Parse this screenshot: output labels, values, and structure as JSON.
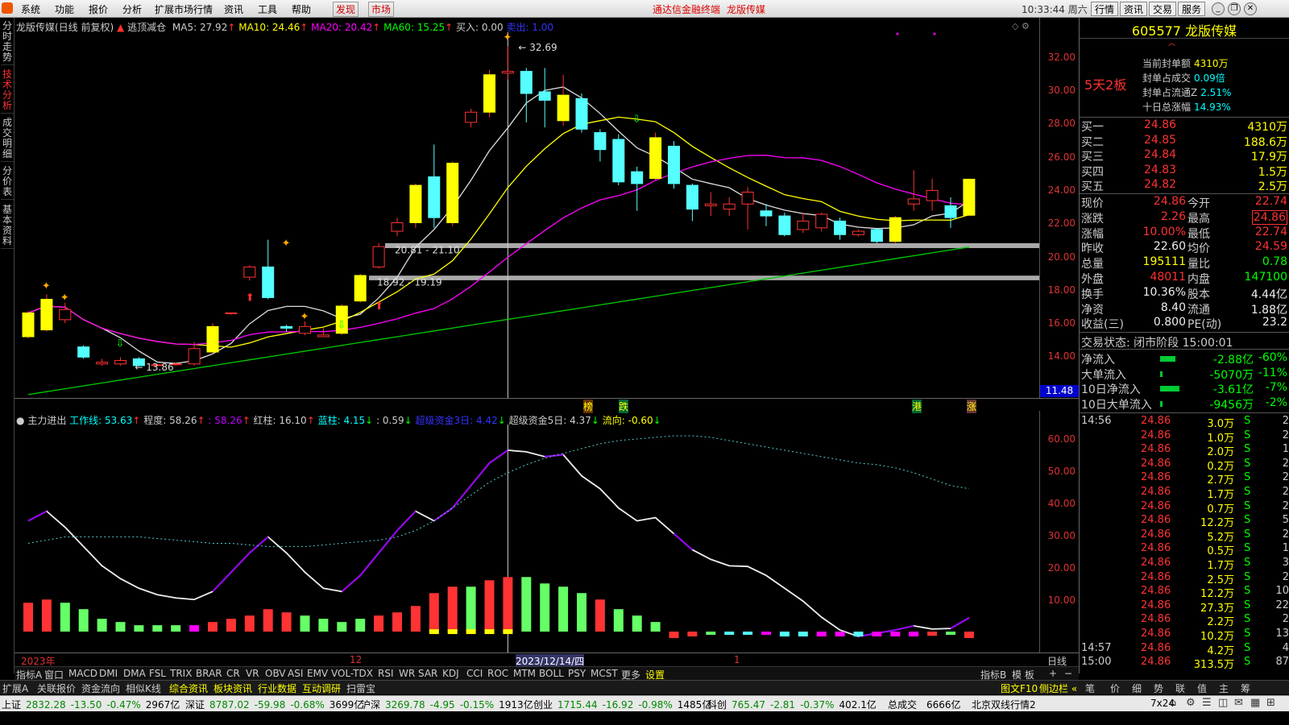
{
  "menu": {
    "items": [
      "系统",
      "功能",
      "报价",
      "分析",
      "扩展市场行情",
      "资讯",
      "工具",
      "帮助"
    ],
    "discover": "发现",
    "market": "市场",
    "app_title": "通达信金融终端",
    "stock_title": "龙版传媒",
    "time": "10:33:44 周六",
    "right_buttons": [
      "行情",
      "资讯",
      "交易",
      "服务"
    ]
  },
  "left_tabs": [
    "分时走势",
    "技术分析",
    "成交明细",
    "分价表",
    "基本资料"
  ],
  "chart_header": {
    "name": "龙版传媒(日线 前复权)",
    "indicator": "逃顶减仓",
    "ma5": "MA5: 27.92",
    "ma10": "MA10: 24.46",
    "ma20": "MA20: 20.42",
    "ma60": "MA60: 15.25",
    "buy": "买入: 0.00",
    "sell": "卖出: 1.00"
  },
  "chart_annotations": {
    "high_label": "32.69",
    "low_label": "13.86",
    "band1": "20.81 - 21.10",
    "band2": "18.92 - 19.19",
    "mark_bang": "榜",
    "mark_die": "跌",
    "mark_gang": "港",
    "mark_zhang": "涨",
    "last_price_tag": "11.48"
  },
  "price_axis": [
    "32.00",
    "30.00",
    "28.00",
    "26.00",
    "24.00",
    "22.00",
    "20.00",
    "18.00",
    "16.00",
    "14.00"
  ],
  "indicator_header": {
    "name": "主力进出",
    "work": "工作线: 53.63",
    "degree": "程度: 58.26",
    "v3": ": 58.26",
    "red": "红柱: 16.10",
    "blue": "蓝柱: 4.15",
    "v6": ": 0.59",
    "super3": "超级资金3日: 4.42",
    "super5": "超级资金5日: 4.37",
    "flow": "流向: -0.60"
  },
  "ind_axis": [
    "60.00",
    "50.00",
    "40.00",
    "30.00",
    "20.00",
    "10.00"
  ],
  "date_axis": {
    "y2023": "2023年",
    "m12": "12",
    "cursor": "2023/12/14/四",
    "m1": "1"
  },
  "chart_data": {
    "type": "candlestick",
    "title": "龙版传媒(日线 前复权)",
    "candles": [
      {
        "o": 15.6,
        "c": 17.0,
        "h": 17.1,
        "l": 15.5
      },
      {
        "o": 16.0,
        "c": 17.8,
        "h": 18.1,
        "l": 15.9
      },
      {
        "o": 16.6,
        "c": 17.2,
        "h": 17.6,
        "l": 16.4
      },
      {
        "o": 15.0,
        "c": 14.4,
        "h": 15.1,
        "l": 14.3
      },
      {
        "o": 14.0,
        "c": 14.1,
        "h": 14.3,
        "l": 13.9
      },
      {
        "o": 14.0,
        "c": 14.2,
        "h": 14.4,
        "l": 13.9
      },
      {
        "o": 14.3,
        "c": 13.9,
        "h": 14.4,
        "l": 13.86
      },
      {
        "o": 13.9,
        "c": 13.95,
        "h": 14.0,
        "l": 13.86
      },
      {
        "o": 14.0,
        "c": 14.0,
        "h": 14.1,
        "l": 13.9
      },
      {
        "o": 14.0,
        "c": 14.9,
        "h": 15.3,
        "l": 13.9
      },
      {
        "o": 14.7,
        "c": 16.2,
        "h": 16.4,
        "l": 14.6
      },
      {
        "o": 17.0,
        "c": 17.0,
        "h": 17.0,
        "l": 16.9
      },
      {
        "o": 19.1,
        "c": 19.7,
        "h": 19.8,
        "l": 18.9
      },
      {
        "o": 19.7,
        "c": 17.9,
        "h": 21.3,
        "l": 17.8
      },
      {
        "o": 16.2,
        "c": 16.1,
        "h": 16.3,
        "l": 15.9
      },
      {
        "o": 15.8,
        "c": 16.2,
        "h": 16.5,
        "l": 15.7
      },
      {
        "o": 15.6,
        "c": 15.7,
        "h": 16.1,
        "l": 15.6
      },
      {
        "o": 15.8,
        "c": 17.4,
        "h": 17.5,
        "l": 15.7
      },
      {
        "o": 17.7,
        "c": 19.2,
        "h": 19.3,
        "l": 17.6
      },
      {
        "o": 19.7,
        "c": 20.9,
        "h": 21.1,
        "l": 19.6
      },
      {
        "o": 21.8,
        "c": 22.3,
        "h": 22.6,
        "l": 21.5
      },
      {
        "o": 22.3,
        "c": 24.5,
        "h": 24.6,
        "l": 22.0
      },
      {
        "o": 25.0,
        "c": 22.6,
        "h": 26.9,
        "l": 22.0
      },
      {
        "o": 22.3,
        "c": 25.8,
        "h": 25.9,
        "l": 22.1
      },
      {
        "o": 28.2,
        "c": 28.8,
        "h": 29.0,
        "l": 27.9
      },
      {
        "o": 28.8,
        "c": 31.0,
        "h": 31.3,
        "l": 28.5
      },
      {
        "o": 31.1,
        "c": 31.2,
        "h": 32.69,
        "l": 30.7
      },
      {
        "o": 31.2,
        "c": 29.9,
        "h": 31.4,
        "l": 28.2
      },
      {
        "o": 30.0,
        "c": 29.5,
        "h": 31.4,
        "l": 27.9
      },
      {
        "o": 28.3,
        "c": 29.8,
        "h": 31.0,
        "l": 28.0
      },
      {
        "o": 29.6,
        "c": 27.8,
        "h": 29.9,
        "l": 27.6
      },
      {
        "o": 27.6,
        "c": 26.6,
        "h": 27.8,
        "l": 25.9
      },
      {
        "o": 27.2,
        "c": 24.7,
        "h": 27.5,
        "l": 24.5
      },
      {
        "o": 25.3,
        "c": 24.6,
        "h": 25.6,
        "l": 23.0
      },
      {
        "o": 24.9,
        "c": 27.3,
        "h": 27.6,
        "l": 24.8
      },
      {
        "o": 26.8,
        "c": 24.6,
        "h": 27.1,
        "l": 24.3
      },
      {
        "o": 24.5,
        "c": 23.1,
        "h": 24.6,
        "l": 22.4
      },
      {
        "o": 23.3,
        "c": 23.4,
        "h": 24.1,
        "l": 22.7
      },
      {
        "o": 23.1,
        "c": 23.4,
        "h": 23.8,
        "l": 22.7
      },
      {
        "o": 23.4,
        "c": 24.1,
        "h": 24.4,
        "l": 21.9
      },
      {
        "o": 23.0,
        "c": 22.7,
        "h": 23.4,
        "l": 22.1
      },
      {
        "o": 22.7,
        "c": 21.6,
        "h": 22.9,
        "l": 21.5
      },
      {
        "o": 21.9,
        "c": 22.4,
        "h": 22.9,
        "l": 21.7
      },
      {
        "o": 22.0,
        "c": 22.8,
        "h": 22.9,
        "l": 21.8
      },
      {
        "o": 22.4,
        "c": 21.6,
        "h": 22.6,
        "l": 21.3
      },
      {
        "o": 21.6,
        "c": 21.8,
        "h": 21.9,
        "l": 21.5
      },
      {
        "o": 21.9,
        "c": 21.2,
        "h": 22.0,
        "l": 21.1
      },
      {
        "o": 21.2,
        "c": 22.6,
        "h": 22.7,
        "l": 21.1
      },
      {
        "o": 23.4,
        "c": 23.7,
        "h": 25.4,
        "l": 23.0
      },
      {
        "o": 23.6,
        "c": 24.2,
        "h": 24.9,
        "l": 23.0
      },
      {
        "o": 23.3,
        "c": 22.6,
        "h": 23.8,
        "l": 22.0
      },
      {
        "o": 22.74,
        "c": 24.86,
        "h": 24.86,
        "l": 22.74
      }
    ],
    "ma_series": [
      "MA5",
      "MA10",
      "MA20",
      "MA60"
    ],
    "ylim": [
      12.0,
      33.5
    ]
  },
  "quote": {
    "code_name": "605577 龙版传媒",
    "board_tag": "5天2板",
    "seal_info": [
      {
        "k": "当前封单额",
        "v": "4310万"
      },
      {
        "k": "封单占成交",
        "v": "0.09倍"
      },
      {
        "k": "封单占流通Z",
        "v": "2.51%"
      },
      {
        "k": "十日总涨幅",
        "v": "14.93%"
      }
    ],
    "bids": [
      {
        "k": "买一",
        "p": "24.86",
        "v": "4310万"
      },
      {
        "k": "买二",
        "p": "24.85",
        "v": "188.6万"
      },
      {
        "k": "买三",
        "p": "24.84",
        "v": "17.9万"
      },
      {
        "k": "买四",
        "p": "24.83",
        "v": "1.5万"
      },
      {
        "k": "买五",
        "p": "24.82",
        "v": "2.5万"
      }
    ],
    "stats": [
      {
        "k1": "现价",
        "v1": "24.86",
        "k2": "今开",
        "v2": "22.74",
        "c1": "red",
        "c2": "red"
      },
      {
        "k1": "涨跌",
        "v1": "2.26",
        "k2": "最高",
        "v2": "24.86",
        "c1": "red",
        "c2": "red"
      },
      {
        "k1": "涨幅",
        "v1": "10.00%",
        "k2": "最低",
        "v2": "22.74",
        "c1": "red",
        "c2": "red"
      },
      {
        "k1": "昨收",
        "v1": "22.60",
        "k2": "均价",
        "v2": "24.59",
        "c1": "wht",
        "c2": "red"
      },
      {
        "k1": "总量",
        "v1": "195111",
        "k2": "量比",
        "v2": "0.78",
        "c1": "yel",
        "c2": "grn"
      },
      {
        "k1": "外盘",
        "v1": "48011",
        "k2": "内盘",
        "v2": "147100",
        "c1": "red",
        "c2": "grn"
      },
      {
        "k1": "换手",
        "v1": "10.36%",
        "k2": "股本",
        "v2": "4.44亿",
        "c1": "wht",
        "c2": "wht"
      },
      {
        "k1": "净资",
        "v1": "8.40",
        "k2": "流通",
        "v2": "1.88亿",
        "c1": "wht",
        "c2": "wht"
      },
      {
        "k1": "收益(三)",
        "v1": "0.800",
        "k2": "PE(动)",
        "v2": "23.2",
        "c1": "wht",
        "c2": "wht"
      }
    ],
    "trade_status": "交易状态: 闭市阶段 15:00:01",
    "flows": [
      {
        "k": "净流入",
        "v": "-2.88亿",
        "p": "-60%",
        "bar": 0.6
      },
      {
        "k": "大单流入",
        "v": "-5070万",
        "p": "-11%",
        "bar": 0.05
      },
      {
        "k": "10日净流入",
        "v": "-3.61亿",
        "p": "-7%",
        "bar": 0.75
      },
      {
        "k": "10日大单流入",
        "v": "-9456万",
        "p": "-2%",
        "bar": 0.05
      }
    ],
    "ticks": [
      {
        "t": "14:56",
        "p": "24.86",
        "v": "3.0万",
        "s": "S",
        "n": "2"
      },
      {
        "t": "",
        "p": "24.86",
        "v": "1.0万",
        "s": "S",
        "n": "2"
      },
      {
        "t": "",
        "p": "24.86",
        "v": "2.0万",
        "s": "S",
        "n": "1"
      },
      {
        "t": "",
        "p": "24.86",
        "v": "0.2万",
        "s": "S",
        "n": "2"
      },
      {
        "t": "",
        "p": "24.86",
        "v": "2.7万",
        "s": "S",
        "n": "2"
      },
      {
        "t": "",
        "p": "24.86",
        "v": "1.7万",
        "s": "S",
        "n": "2"
      },
      {
        "t": "",
        "p": "24.86",
        "v": "0.7万",
        "s": "S",
        "n": "2"
      },
      {
        "t": "",
        "p": "24.86",
        "v": "12.2万",
        "s": "S",
        "n": "5"
      },
      {
        "t": "",
        "p": "24.86",
        "v": "5.2万",
        "s": "S",
        "n": "2"
      },
      {
        "t": "",
        "p": "24.86",
        "v": "0.5万",
        "s": "S",
        "n": "1"
      },
      {
        "t": "",
        "p": "24.86",
        "v": "1.7万",
        "s": "S",
        "n": "3"
      },
      {
        "t": "",
        "p": "24.86",
        "v": "2.5万",
        "s": "S",
        "n": "2"
      },
      {
        "t": "",
        "p": "24.86",
        "v": "12.2万",
        "s": "S",
        "n": "10"
      },
      {
        "t": "",
        "p": "24.86",
        "v": "27.3万",
        "s": "S",
        "n": "22"
      },
      {
        "t": "",
        "p": "24.86",
        "v": "2.2万",
        "s": "S",
        "n": "2"
      },
      {
        "t": "",
        "p": "24.86",
        "v": "10.2万",
        "s": "S",
        "n": "13"
      },
      {
        "t": "14:57",
        "p": "24.86",
        "v": "4.2万",
        "s": "S",
        "n": "4"
      },
      {
        "t": "15:00",
        "p": "24.86",
        "v": "313.5万",
        "s": "S",
        "n": "87"
      }
    ]
  },
  "indicator_tabs": [
    "指标A",
    "窗口",
    "MACD",
    "DMI",
    "DMA",
    "FSL",
    "TRIX",
    "BRAR",
    "CR",
    "VR",
    "OBV",
    "ASI",
    "EMV",
    "VOL-TDX",
    "RSI",
    "WR",
    "SAR",
    "KDJ",
    "CCI",
    "ROC",
    "MTM",
    "BOLL",
    "PSY",
    "MCST",
    "更多",
    "设置"
  ],
  "indicator_right": [
    "指标B",
    "模 板",
    "+",
    "−"
  ],
  "period_label": "日线",
  "ext_tabs": [
    "扩展A",
    "关联报价",
    "资金流向",
    "相似K线",
    "综合资讯",
    "板块资讯",
    "行业数据",
    "互动调研",
    "扫雷宝"
  ],
  "ext_right": [
    "图文F10",
    "侧边栏 «",
    "笔",
    "价",
    "细",
    "势",
    "联",
    "值",
    "主",
    "筹"
  ],
  "status": [
    {
      "n": "上证",
      "v": "2832.28",
      "c": "-13.50",
      "p": "-0.47%",
      "a": "2967亿"
    },
    {
      "n": "深证",
      "v": "8787.02",
      "c": "-59.98",
      "p": "-0.68%",
      "a": "3699亿"
    },
    {
      "n": "沪深",
      "v": "3269.78",
      "c": "-4.95",
      "p": "-0.15%",
      "a": "1913亿"
    },
    {
      "n": "创业",
      "v": "1715.44",
      "c": "-16.92",
      "p": "-0.98%",
      "a": "1485亿"
    },
    {
      "n": "科创",
      "v": "765.47",
      "c": "-2.81",
      "p": "-0.37%",
      "a": "402.1亿"
    }
  ],
  "status_total_label": "总成交",
  "status_total": "6666亿",
  "status_right": "北京双线行情2",
  "status_time": "7x24"
}
